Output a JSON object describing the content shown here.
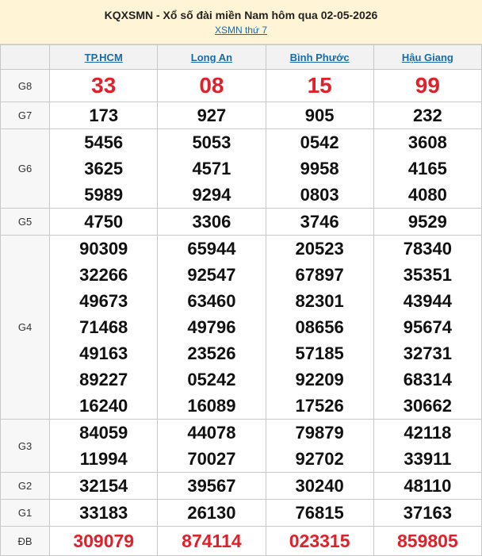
{
  "header": {
    "title": "KQXSMN - Xổ số đài miền Nam hôm qua 02-05-2026",
    "link": "XSMN thứ 7"
  },
  "provinces": [
    "TP.HCM",
    "Long An",
    "Bình Phước",
    "Hậu Giang"
  ],
  "prizes": [
    {
      "label": "G8",
      "values": [
        [
          "33"
        ],
        [
          "08"
        ],
        [
          "15"
        ],
        [
          "99"
        ]
      ]
    },
    {
      "label": "G7",
      "values": [
        [
          "173"
        ],
        [
          "927"
        ],
        [
          "905"
        ],
        [
          "232"
        ]
      ]
    },
    {
      "label": "G6",
      "values": [
        [
          "5456",
          "3625",
          "5989"
        ],
        [
          "5053",
          "4571",
          "9294"
        ],
        [
          "0542",
          "9958",
          "0803"
        ],
        [
          "3608",
          "4165",
          "4080"
        ]
      ]
    },
    {
      "label": "G5",
      "values": [
        [
          "4750"
        ],
        [
          "3306"
        ],
        [
          "3746"
        ],
        [
          "9529"
        ]
      ]
    },
    {
      "label": "G4",
      "values": [
        [
          "90309",
          "32266",
          "49673",
          "71468",
          "49163",
          "89227",
          "16240"
        ],
        [
          "65944",
          "92547",
          "63460",
          "49796",
          "23526",
          "05242",
          "16089"
        ],
        [
          "20523",
          "67897",
          "82301",
          "08656",
          "57185",
          "92209",
          "17526"
        ],
        [
          "78340",
          "35351",
          "43944",
          "95674",
          "32731",
          "68314",
          "30662"
        ]
      ]
    },
    {
      "label": "G3",
      "values": [
        [
          "84059",
          "11994"
        ],
        [
          "44078",
          "70027"
        ],
        [
          "79879",
          "92702"
        ],
        [
          "42118",
          "33911"
        ]
      ]
    },
    {
      "label": "G2",
      "values": [
        [
          "32154"
        ],
        [
          "39567"
        ],
        [
          "30240"
        ],
        [
          "48110"
        ]
      ]
    },
    {
      "label": "G1",
      "values": [
        [
          "33183"
        ],
        [
          "26130"
        ],
        [
          "76815"
        ],
        [
          "37163"
        ]
      ]
    },
    {
      "label": "ĐB",
      "values": [
        [
          "309079"
        ],
        [
          "874114"
        ],
        [
          "023315"
        ],
        [
          "859805"
        ]
      ]
    }
  ]
}
